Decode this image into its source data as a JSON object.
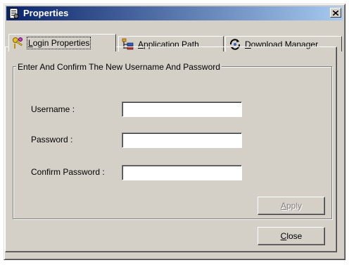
{
  "window": {
    "title": "Properties",
    "icon": "properties-window-icon",
    "close_glyph": "✕"
  },
  "tabs": [
    {
      "label": "Login Properties",
      "mnemonic": "L",
      "rest": "ogin Properties",
      "icon": "keys-icon",
      "active": true
    },
    {
      "label": "Application Path",
      "mnemonic": "A",
      "rest": "pplication Path",
      "icon": "folder-tree-icon",
      "active": false
    },
    {
      "label": "Download Manager",
      "mnemonic": "D",
      "rest": "ownload Manager",
      "icon": "download-manager-icon",
      "active": false
    }
  ],
  "group": {
    "title": "Enter And Confirm The New Username And Password"
  },
  "fields": {
    "username": {
      "label": "Username :",
      "value": ""
    },
    "password": {
      "label": "Password :",
      "value": ""
    },
    "confirm": {
      "label": "Confirm Password :",
      "value": ""
    }
  },
  "buttons": {
    "apply": {
      "mnemonic": "A",
      "rest": "pply",
      "enabled": false
    },
    "close": {
      "mnemonic": "C",
      "rest": "lose",
      "enabled": true
    }
  },
  "colors": {
    "face": "#d4d0c8",
    "title_start": "#0a246a",
    "title_end": "#a6caf0"
  }
}
